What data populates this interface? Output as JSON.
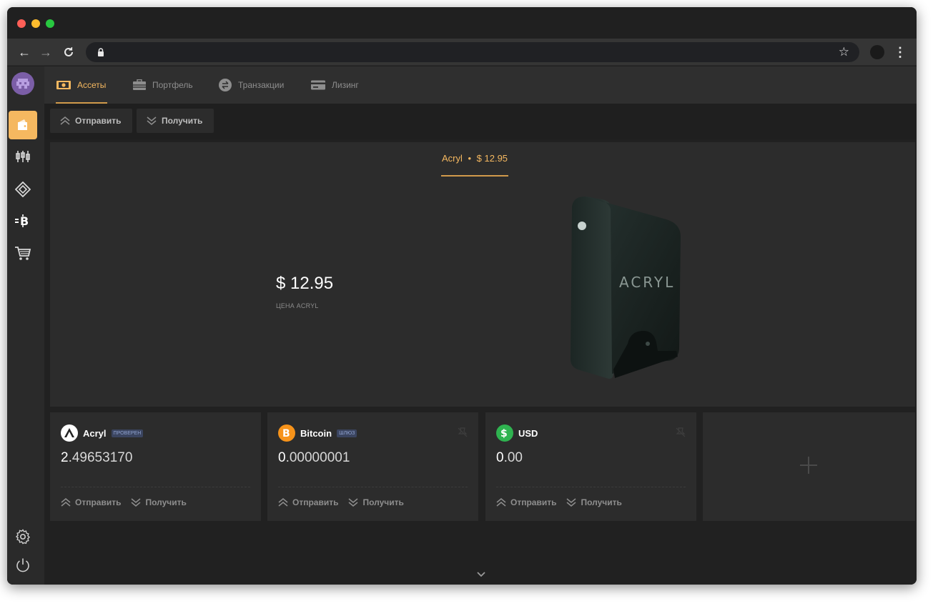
{
  "browser": {
    "url": "",
    "nav": {
      "back": "←",
      "forward": "→",
      "reload": "⟳"
    },
    "star_glyph": "☆",
    "menu_glyph": "⋮"
  },
  "sidebar": {
    "items": [
      {
        "icon": "wallet-icon",
        "active": true
      },
      {
        "icon": "candlestick-chart-icon",
        "active": false
      },
      {
        "icon": "diamond-icon",
        "active": false
      },
      {
        "icon": "bitcoin-transfer-icon",
        "active": false
      },
      {
        "icon": "cart-icon",
        "active": false
      }
    ],
    "bottom": [
      "gear-icon",
      "power-icon"
    ]
  },
  "tabs": [
    {
      "label": "Ассеты",
      "active": true,
      "icon": "money-icon"
    },
    {
      "label": "Портфель",
      "active": false,
      "icon": "briefcase-icon"
    },
    {
      "label": "Транзакции",
      "active": false,
      "icon": "transactions-icon"
    },
    {
      "label": "Лизинг",
      "active": false,
      "icon": "card-icon"
    }
  ],
  "actions": {
    "send": "Отправить",
    "receive": "Получить"
  },
  "hero": {
    "tab_asset": "Acryl",
    "tab_sep": "•",
    "tab_price": "$ 12.95",
    "price": "$ 12.95",
    "price_label": "ЦЕНА ACRYL",
    "device_logo": "ACRYL"
  },
  "cards": [
    {
      "name": "Acryl",
      "badge": "ПРОВЕРЕН",
      "balance_lead": "2",
      "balance_rest": ".49653170",
      "icon": "acryl-icon",
      "pin": false
    },
    {
      "name": "Bitcoin",
      "badge": "ШЛЮЗ",
      "balance_lead": "0",
      "balance_rest": ".00000001",
      "icon": "bitcoin-icon",
      "pin": true
    },
    {
      "name": "USD",
      "badge": "",
      "balance_lead": "0",
      "balance_rest": ".00",
      "icon": "dollar-icon",
      "pin": true
    }
  ],
  "colors": {
    "accent": "#f5b860",
    "background": "#212121",
    "panel": "#2c2c2c",
    "bitcoin": "#f7931a",
    "usd": "#2fb350"
  }
}
